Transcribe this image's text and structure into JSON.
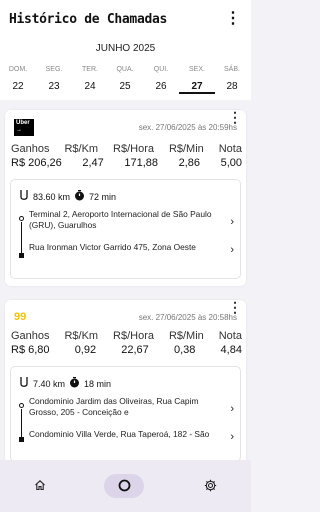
{
  "header": {
    "title": "Histórico de Chamadas"
  },
  "calendar": {
    "month": "JUNHO 2025",
    "days": [
      {
        "name": "DOM.",
        "num": "22"
      },
      {
        "name": "SEG.",
        "num": "23"
      },
      {
        "name": "TER.",
        "num": "24"
      },
      {
        "name": "QUA.",
        "num": "25"
      },
      {
        "name": "QUI.",
        "num": "26"
      },
      {
        "name": "SEX.",
        "num": "27",
        "selected": true
      },
      {
        "name": "SÁB.",
        "num": "28"
      }
    ]
  },
  "rides": [
    {
      "app": "Uber",
      "app_logo_text": "Uber",
      "date": "sex. 27/06/2025 às 20:59hs",
      "metrics": {
        "labels": [
          "Ganhos",
          "R$/Km",
          "R$/Hora",
          "R$/Min",
          "Nota"
        ],
        "values": [
          "R$ 206,26",
          "2,47",
          "171,88",
          "2,86",
          "5,00"
        ]
      },
      "distance": "83.60 km",
      "duration": "72 min",
      "origin": "Terminal 2, Aeroporto Internacional de São Paulo (GRU), Guarulhos",
      "destination": "Rua Ironman Victor Garrido 475, Zona Oeste"
    },
    {
      "app": "99",
      "app_logo_text": "99",
      "date": "sex. 27/06/2025 às 20:58hs",
      "metrics": {
        "labels": [
          "Ganhos",
          "R$/Km",
          "R$/Hora",
          "R$/Min",
          "Nota"
        ],
        "values": [
          "R$ 6,80",
          "0,92",
          "22,67",
          "0,38",
          "4,84"
        ]
      },
      "distance": "7.40 km",
      "duration": "18 min",
      "origin": "Condominio Jardim das Oliveiras, Rua Capim Grosso, 205 - Conceição e",
      "destination": "Condominio Villa Verde, Rua Taperoá, 182 - São"
    }
  ],
  "nav": {
    "items": [
      "home-icon",
      "circle-icon",
      "settings-icon"
    ],
    "active": 1
  },
  "colors": {
    "accent_99": "#f5c200",
    "nav_bg": "#eeeaf3",
    "nav_active": "#dcd5ea"
  }
}
